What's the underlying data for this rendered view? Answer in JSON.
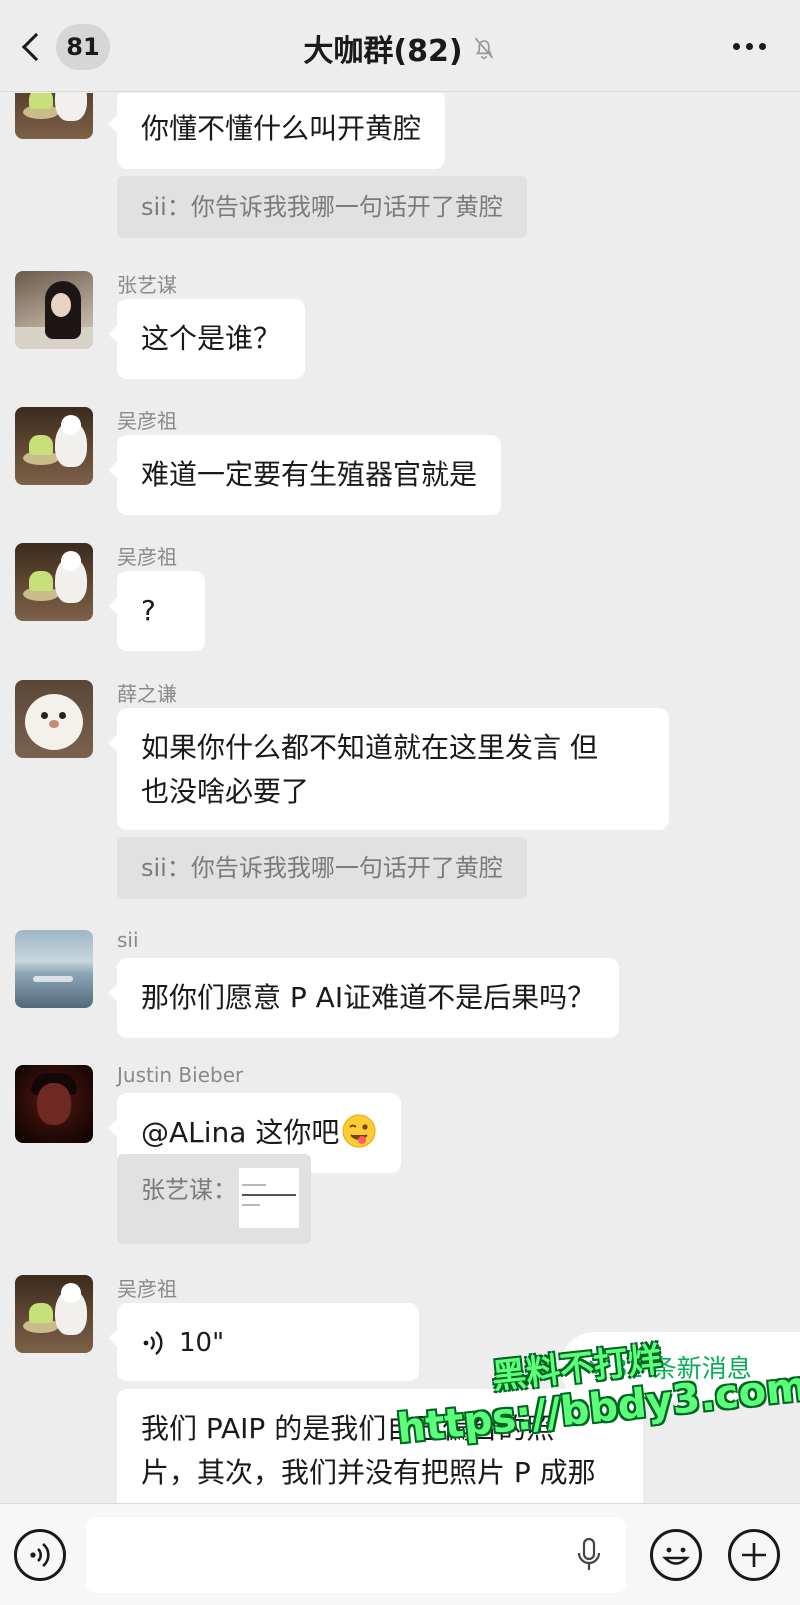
{
  "header": {
    "back_count": "81",
    "title": "大咖群(82)",
    "icons": [
      "chevron-left-icon",
      "mute-bell-icon",
      "more-dots-icon"
    ]
  },
  "messages": [
    {
      "sender": "",
      "text": "你懂不懂什么叫开黄腔",
      "quote": "sii：你告诉我我哪一句话开了黄腔"
    },
    {
      "sender": "张艺谋",
      "text": "这个是谁？"
    },
    {
      "sender": "吴彦祖",
      "text": "难道一定要有生殖器官就是"
    },
    {
      "sender": "吴彦祖",
      "text": "?"
    },
    {
      "sender": "薛之谦",
      "line1": "如果你什么都不知道就在这里发言 但",
      "line2": "也没啥必要了",
      "quote": "sii：你告诉我我哪一句话开了黄腔"
    },
    {
      "sender": "sii",
      "text": "那你们愿意 P AI证难道不是后果吗？"
    },
    {
      "sender": "Justin Bieber",
      "text": "@ALina 这你吧",
      "emoji": "winking-face-tongue-emoji",
      "quote_label": "张艺谋："
    },
    {
      "sender": "吴彦祖",
      "voice_duration": "10\"",
      "line1": "我们 PAIP 的是我们自己偏台的照",
      "line2": "片，其次，我们并没有把照片 P 成那"
    }
  ],
  "new_messages": {
    "label": "32 条新消息"
  },
  "watermark": {
    "line1": "黑料不打烊",
    "line2": "https://bbdy3.com"
  },
  "input_bar": {
    "icons": [
      "voice-toggle-icon",
      "microphone-icon",
      "emoji-icon",
      "plus-icon"
    ]
  },
  "colors": {
    "background": "#ededed",
    "bubble": "#ffffff",
    "quote_bg": "#e1e1e1",
    "accent_green": "#06ae56"
  }
}
